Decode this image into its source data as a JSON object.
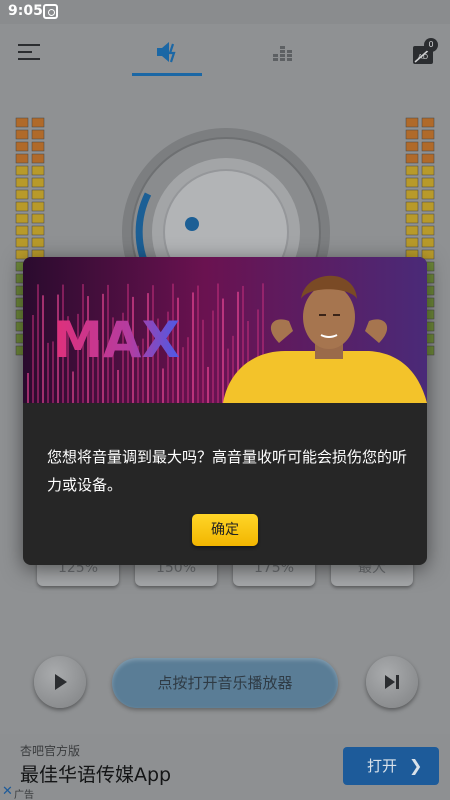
{
  "status_bar": {
    "time": "9:05"
  },
  "app": {
    "presets": [
      "125%",
      "150%",
      "175%",
      "最大"
    ],
    "open_player_label": "点按打开音乐播放器",
    "noads_badge": "0"
  },
  "dialog": {
    "banner_text": "MAX",
    "message": "您想将音量调到最大吗？高音量收听可能会损伤您的听力或设备。",
    "confirm_label": "确定"
  },
  "ad": {
    "source": "杏吧官方版",
    "title": "最佳华语传媒App",
    "open_label": "打开",
    "open_chevron": "❯",
    "close_glyph": "✕",
    "label": "广告"
  },
  "colors": {
    "accent_blue": "#1b67a5",
    "confirm_yellow": "#f7c600",
    "dialog_bg": "#262626"
  }
}
